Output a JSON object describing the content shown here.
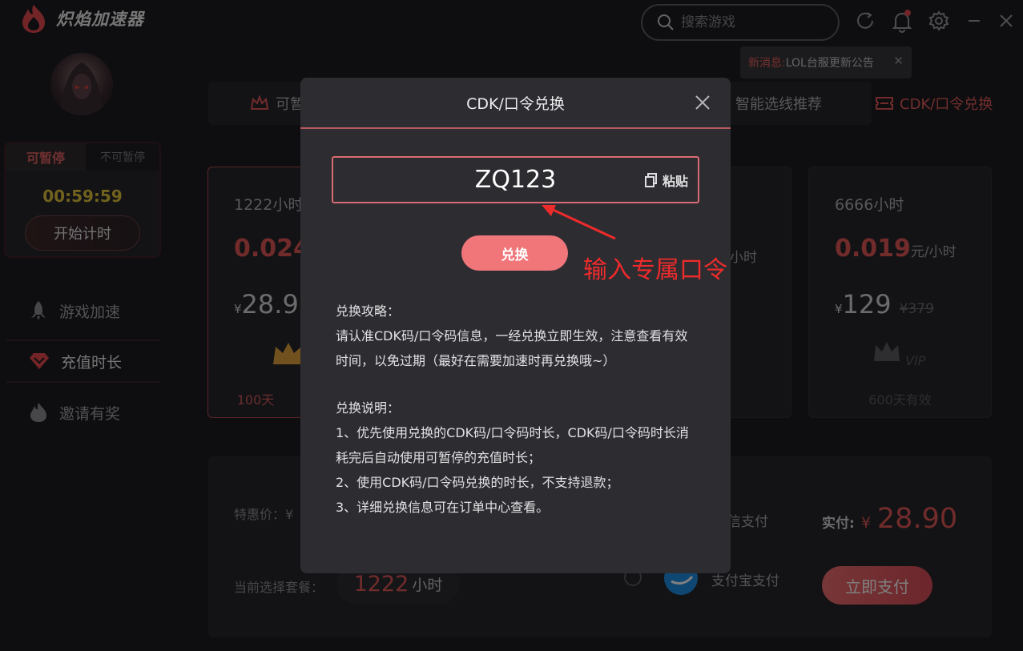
{
  "app": {
    "name": "炽焰加速器"
  },
  "header": {
    "search_placeholder": "搜索游戏",
    "icons": [
      "refresh-icon",
      "bell-icon",
      "gear-icon",
      "minimize-icon",
      "close-icon"
    ],
    "notice": {
      "prefix": "新消息:",
      "text": "LOL台服更新公告"
    }
  },
  "sidebar": {
    "timer_tabs": [
      "可暂停",
      "不可暂停"
    ],
    "timer_value": "00:59:59",
    "start_label": "开始计时",
    "nav": [
      {
        "label": "游戏加速",
        "icon": "rocket-icon"
      },
      {
        "label": "充值时长",
        "icon": "diamond-icon"
      },
      {
        "label": "邀请有奖",
        "icon": "flame-icon"
      }
    ]
  },
  "tabs": {
    "first_partial": "可暂",
    "route": "智能选线推荐",
    "cdk": "CDK/口令兑换"
  },
  "plans": [
    {
      "hours": "1222小时",
      "rate": "0.024",
      "price": "28.9",
      "valid": "100天"
    },
    {
      "rate_unit": "小时"
    },
    {
      "hours": "6666小时",
      "rate": "0.019",
      "rate_unit": "元/小时",
      "price": "129",
      "old_price": "¥379",
      "vip": "VIP",
      "valid": "600天有效"
    }
  ],
  "payment": {
    "special_label": "特惠价：¥",
    "current_label": "当前选择套餐：",
    "current_value": "1222",
    "current_unit": "小时",
    "wechat": "信支付",
    "alipay": "支付宝支付",
    "total_label": "实付:",
    "currency": "¥",
    "total": "28.90",
    "pay_now": "立即支付"
  },
  "modal": {
    "title": "CDK/口令兑换",
    "code_value": "ZQ123",
    "paste_label": "粘贴",
    "redeem_label": "兑换",
    "guide_title": "兑换攻略：",
    "guide_text": "请认准CDK码/口令码信息，一经兑换立即生效，注意查看有效时间，以免过期（最好在需要加速时再兑换哦~）",
    "notes_title": "兑换说明：",
    "notes": [
      "1、优先使用兑换的CDK码/口令码时长，CDK码/口令码时长消耗完后自动使用可暂停的充值时长；",
      "2、使用CDK码/口令码兑换的时长，不支持退款；",
      "3、详细兑换信息可在订单中心查看。"
    ]
  },
  "annotation": {
    "text": "输入专属口令"
  },
  "colors": {
    "accent": "#e45757",
    "button": "#f0767a",
    "panel": "#2d2c31",
    "background": "#1d1d21"
  }
}
